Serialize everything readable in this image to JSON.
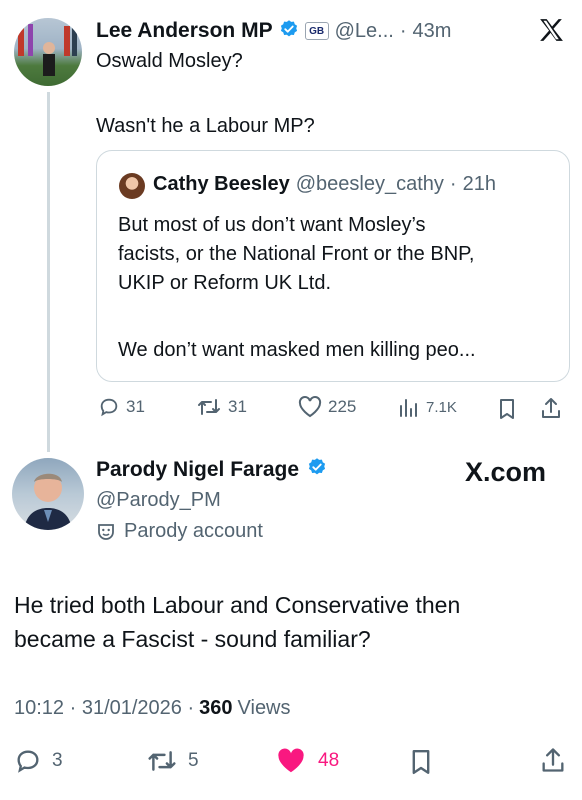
{
  "top_tweet": {
    "name": "Lee Anderson MP",
    "affiliation_badge": "GB",
    "handle": "@Le...",
    "sep": "·",
    "time": "43m",
    "line1": "Oswald Mosley?",
    "line2": "Wasn't he a Labour MP?",
    "quote": {
      "name": "Cathy Beesley",
      "handle": "@beesley_cathy",
      "sep": "·",
      "time": "21h",
      "para1_l1": "But most of us don’t want Mosley’s",
      "para1_l2": "facists, or the National Front or the BNP,",
      "para1_l3": "UKIP or Reform UK Ltd.",
      "para2": "We don’t want masked men killing peo..."
    },
    "stats": {
      "replies": "31",
      "reposts": "31",
      "likes": "225",
      "views": "7.1K"
    }
  },
  "reply_tweet": {
    "name": "Parody Nigel Farage",
    "handle": "@Parody_PM",
    "parody_label": "Parody account",
    "brand": "X.com",
    "line1": "He tried both Labour and Conservative then",
    "line2": "became a Fascist - sound familiar?",
    "timestamp": "10:12 · 31/01/2026 ·",
    "views_count": "360",
    "views_label": "Views",
    "stats": {
      "replies": "3",
      "reposts": "5",
      "likes": "48"
    }
  },
  "colors": {
    "verified": "#1d9bf0",
    "like": "#f91880",
    "muted": "#536471"
  }
}
